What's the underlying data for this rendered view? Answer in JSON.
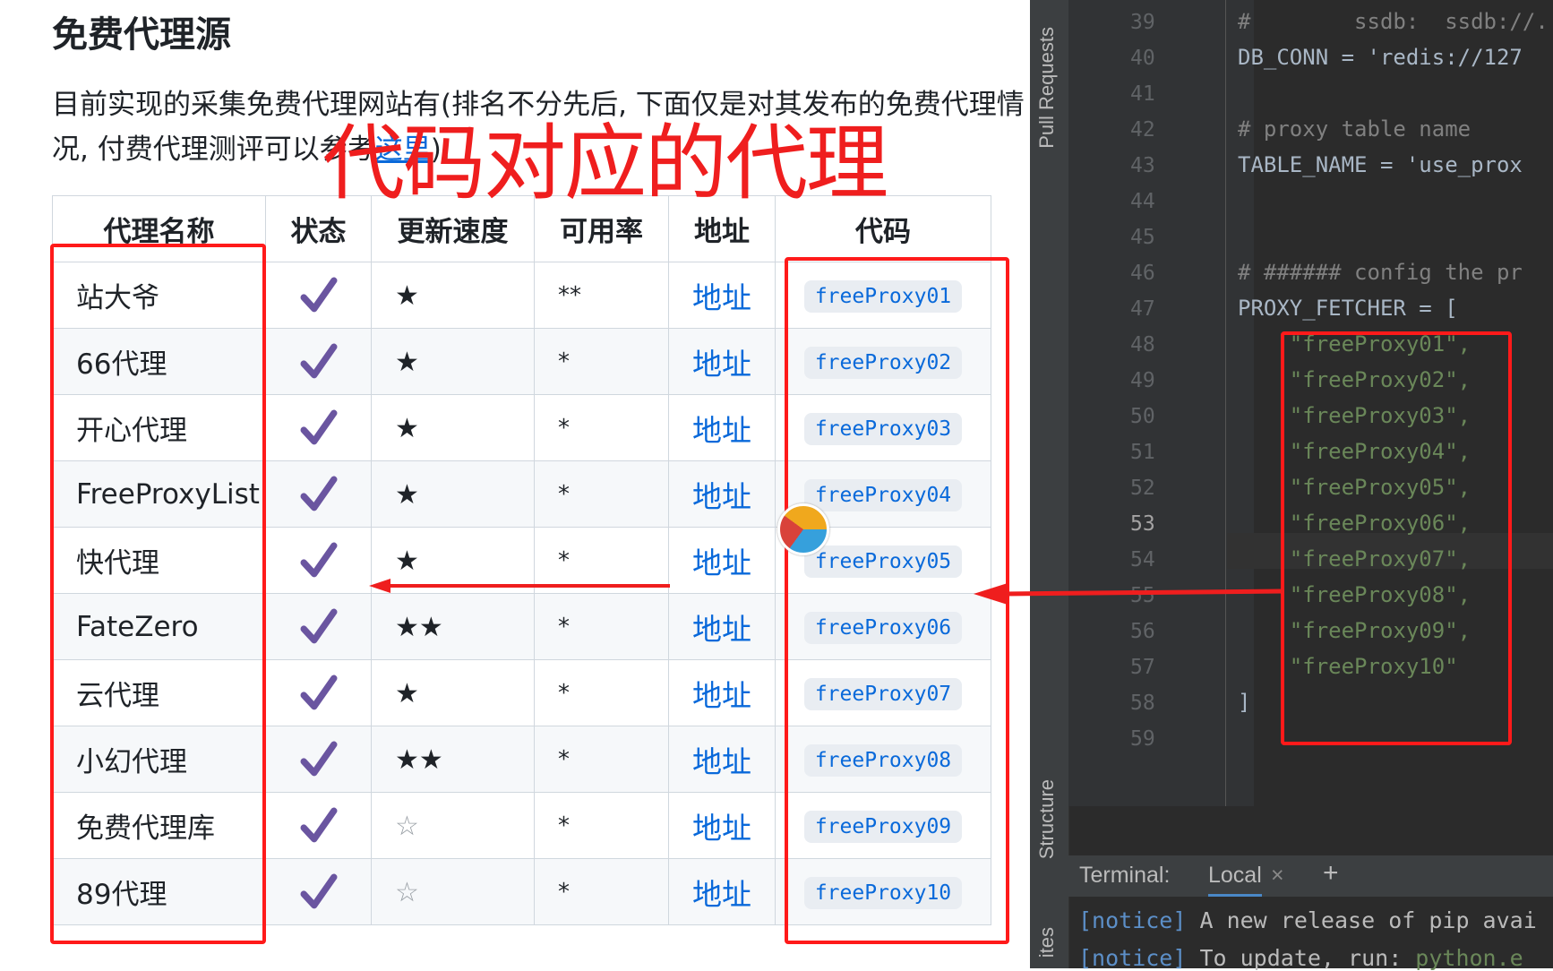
{
  "doc": {
    "heading": "免费代理源",
    "intro_before_link": "目前实现的采集免费代理网站有(排名不分先后, 下面仅是对其发布的免费代理情况, 付费代理测评可以参考",
    "intro_link": "这里",
    "intro_after_link": "):",
    "table": {
      "headers": [
        "代理名称",
        "状态",
        "更新速度",
        "可用率",
        "地址",
        "代码"
      ],
      "rows": [
        {
          "name": "站大爷",
          "speed": "★",
          "rate": "**",
          "addr": "地址",
          "code": "freeProxy01"
        },
        {
          "name": "66代理",
          "speed": "★",
          "rate": "*",
          "addr": "地址",
          "code": "freeProxy02"
        },
        {
          "name": "开心代理",
          "speed": "★",
          "rate": "*",
          "addr": "地址",
          "code": "freeProxy03"
        },
        {
          "name": "FreeProxyList",
          "speed": "★",
          "rate": "*",
          "addr": "地址",
          "code": "freeProxy04"
        },
        {
          "name": "快代理",
          "speed": "★",
          "rate": "*",
          "addr": "地址",
          "code": "freeProxy05"
        },
        {
          "name": "FateZero",
          "speed": "★★",
          "rate": "*",
          "addr": "地址",
          "code": "freeProxy06"
        },
        {
          "name": "云代理",
          "speed": "★",
          "rate": "*",
          "addr": "地址",
          "code": "freeProxy07"
        },
        {
          "name": "小幻代理",
          "speed": "★★",
          "rate": "*",
          "addr": "地址",
          "code": "freeProxy08"
        },
        {
          "name": "免费代理库",
          "speed": "☆",
          "rate": "*",
          "addr": "地址",
          "code": "freeProxy09"
        },
        {
          "name": "89代理",
          "speed": "☆",
          "rate": "*",
          "addr": "地址",
          "code": "freeProxy10"
        }
      ]
    },
    "annotation_title": "代码对应的代理"
  },
  "ide": {
    "side_labels": {
      "pull_requests": "Pull Requests",
      "structure": "Structure",
      "favorites": "ites"
    },
    "lines": [
      {
        "n": "39",
        "text": "#        ssdb:  ssdb://..."
      },
      {
        "n": "40",
        "text": "DB_CONN = 'redis://127"
      },
      {
        "n": "41",
        "text": ""
      },
      {
        "n": "42",
        "text": "# proxy table name"
      },
      {
        "n": "43",
        "text": "TABLE_NAME = 'use_prox"
      },
      {
        "n": "44",
        "text": ""
      },
      {
        "n": "45",
        "text": ""
      },
      {
        "n": "46",
        "text": "# ###### config the pr"
      },
      {
        "n": "47",
        "text": "PROXY_FETCHER = ["
      },
      {
        "n": "48",
        "text": "    \"freeProxy01\","
      },
      {
        "n": "49",
        "text": "    \"freeProxy02\","
      },
      {
        "n": "50",
        "text": "    \"freeProxy03\","
      },
      {
        "n": "51",
        "text": "    \"freeProxy04\","
      },
      {
        "n": "52",
        "text": "    \"freeProxy05\","
      },
      {
        "n": "53",
        "text": "    \"freeProxy06\","
      },
      {
        "n": "54",
        "text": "    \"freeProxy07\","
      },
      {
        "n": "55",
        "text": "    \"freeProxy08\","
      },
      {
        "n": "56",
        "text": "    \"freeProxy09\","
      },
      {
        "n": "57",
        "text": "    \"freeProxy10\""
      },
      {
        "n": "58",
        "text": "]"
      },
      {
        "n": "59",
        "text": ""
      }
    ],
    "terminal": {
      "label": "Terminal:",
      "tab": "Local",
      "close": "×",
      "add": "+",
      "line1_tag": "[notice]",
      "line1_text": " A new release of pip avai",
      "line2_tag": "[notice]",
      "line2_text": " To update, run: ",
      "line2_cmd": "python.e"
    }
  },
  "colors": {
    "annotation_red": "#ef1e1e",
    "link_blue": "#0969da",
    "check_purple": "#6a55a0"
  }
}
